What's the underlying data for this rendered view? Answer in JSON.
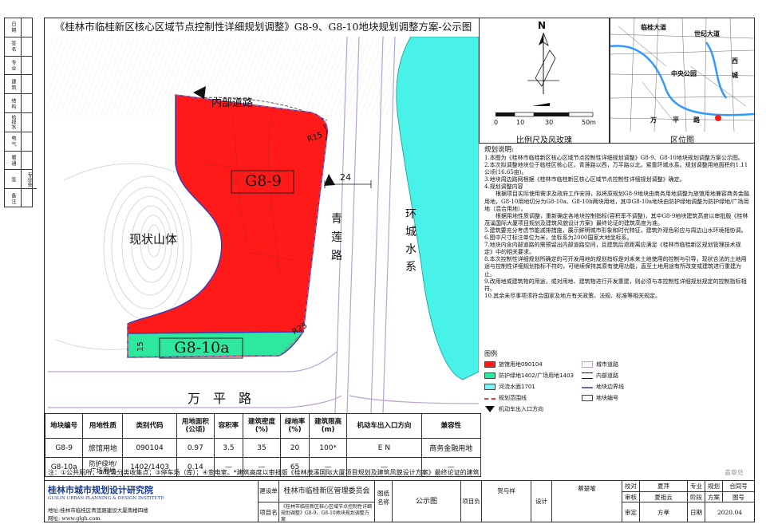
{
  "title": "《桂林市临桂新区核心区域节点控制性详细规划调整》G8-9、G8-10地块规划调整方案-公示图",
  "left_strip": [
    "日 期",
    "签 名",
    "专 业",
    "建 筑",
    "结 构",
    "给排水",
    "电 气",
    "暖 通",
    "专业会签",
    "备 注"
  ],
  "map": {
    "road_inner": "内部道路",
    "road_qinglian": [
      "青",
      "莲",
      "路"
    ],
    "road_wanping": "万　平　路",
    "water": [
      "环",
      "城",
      "水",
      "系"
    ],
    "hill": "现状山体",
    "plot_a": "G8-9",
    "plot_b": "G8-10a",
    "dim_r15": "R15",
    "dim_r25": "R25",
    "dim_24": "24",
    "dim_15": "15"
  },
  "compass": {
    "north": "N",
    "scale_ticks": [
      "0",
      "10",
      "30",
      "50m"
    ],
    "caption": "比例尺及风玫瑰"
  },
  "location": {
    "caption": "区位图",
    "labels": [
      "临桂大道",
      "世纪大道",
      "中央公园",
      "西",
      "城",
      "万",
      "平",
      "路"
    ]
  },
  "desc": {
    "heading": "规划说明:",
    "items": [
      "1.本图为《桂林市临桂新区核心区域节点控制性详细规划调整》G8-9、G8-10地块规划调整方案公示图。",
      "2.本次拟调整地块位于临桂区核心区，青莲路以西，万平路以北，紧靠环城水系。规划调整用地面积约1.11公顷(16.65亩)。",
      "3.地块周边路网根据《桂林市临桂新区核心区域节点控制性详细规划调整》确定。",
      "4.规划调整内容",
      "　　根据项目实际使用需求及政府工作安排，拟将原规划G8-9地块由商务用地调整为旅馆用地兼容商务金融用地，G8-10用地切分为G8-10a、G8-10b两块用地，其中G8-10a地块由防护绿地调整为防护绿地/广场用地（混合用地）。",
      "　　根据用地性质调整，重新确定各地块控制指标(容积率不调整)，其中G8-9地块建筑高度以审批版《桂林茂溪国际大厦项目规划及建筑风貌设计方案》最终论证的建筑高度为准。",
      "5.建筑要充分考虑节能减排措施，展示鲜明城市形象和时代特征，建筑外观色彩应与周边山水环境相协调。",
      "6.图中尺寸标注单位为米，坐标系为2000国家大地坐标系。",
      "7.地块内含内部道路的需预留出内部道路空间，且建筑后退距离应满足《桂林市临桂新区规划管理技术规定》中的相关要求。",
      "8.本次控制性详细规划所确定的可开发用地的规划指标是对未来土地使用的控制与引导，现状合法的土地用途与控制性详细规划指标不符的，可继续保持其原有使用功能，直至土地用途有所改变或建筑进行重建为止。",
      "9.改用地或建筑物的用途，或对用地、建筑物进行开发重建，则必须与本控制性详细规划规定的控制指标相符。",
      "10.其余未尽事项须符合国家及地方有关政策、法规、标准等相关规定。"
    ]
  },
  "legend": {
    "heading": "图例",
    "items": [
      {
        "label": "旅馆用地090104",
        "color": "#ff1a1a"
      },
      {
        "label": "防护绿地1402/广场用地1403",
        "color": "#2ee8a0"
      },
      {
        "label": "河流水面1701",
        "color": "#7ff0f5"
      },
      {
        "label": "规划范围线",
        "color": "#e23b3b"
      },
      {
        "label": "机动车出入口方向",
        "color": "#111111"
      },
      {
        "label": "城市道路",
        "color": "#b9a2d2"
      },
      {
        "label": "内部道路",
        "color": "#222222"
      },
      {
        "label": "地块边界线",
        "color": "#7a5cc4"
      },
      {
        "label": "地块编号",
        "color": "#222222"
      }
    ]
  },
  "table": {
    "headers": [
      "地块编号",
      "用地性质",
      "类别代码",
      "用地面积\n(公顷)",
      "容积率",
      "建筑密度\n(%)",
      "绿地率\n(%)",
      "建筑限高\n(m)",
      "机动车出入口方向",
      "兼容性"
    ],
    "rows": [
      [
        "G8-9",
        "旅馆用地",
        "090104",
        "0.97",
        "3.5",
        "35",
        "20",
        "100*",
        "E N",
        "商务金融用地"
      ],
      [
        "G8-10a",
        "防护绿地/\n广场用地",
        "1402/1403",
        "0.14",
        "—",
        "—",
        "65",
        "—",
        "—",
        "—"
      ]
    ]
  },
  "notes": "注：①公共厕所；②垃圾分类收集点；③停车场（库）；④变电室。*建筑高度以审批版《桂林茂溪国际大厦项目规划及建筑风貌设计方案》最终论证的建筑高度为准。",
  "title_block": {
    "institute": "桂林市城市规划设计研究院",
    "institute_en": "GUILIN URBAN PLANNING & DESIGN INSTITUTE",
    "address": "地址:桂林市临桂区青莲路建设大厦南楼四楼",
    "web": "网址: www.glgh.com",
    "client_label": "建设单位",
    "client": "桂林市临桂新区管理委员会",
    "project_label": "项目名称",
    "project": "《桂林市临桂新区核心区域节点控制性详细规划调整》G8-9、G8-10地块规划调整方案",
    "drawing_label": "图纸名称",
    "drawing": "公示图",
    "roles": [
      "项目负责",
      "贺与祥",
      "设计",
      "蔡楚喻",
      "校对",
      "夏萍",
      "审核",
      "夏祖云",
      "审定",
      "方孝"
    ],
    "fields": [
      "专业",
      "规划",
      "合同号",
      "阶段",
      "方案",
      "图号",
      "日期",
      "2020.04"
    ],
    "stamp": "盖章处"
  }
}
